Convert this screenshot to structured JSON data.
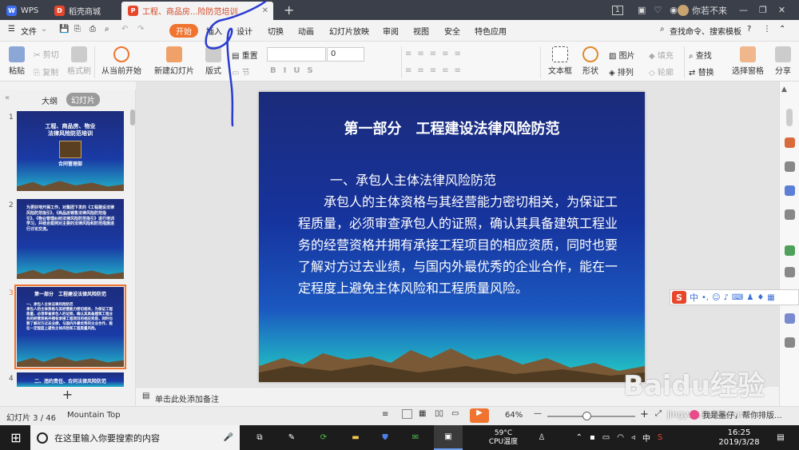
{
  "titlebar": {
    "tabs": [
      {
        "label": "WPS",
        "icon": "wps-logo-icon",
        "color": "#3c6df0"
      },
      {
        "label": "稻壳商城",
        "icon": "docer-icon",
        "color": "#e8462b"
      },
      {
        "label": "工程、商品房...险防范培训",
        "icon": "presentation-icon",
        "color": "#e8462b",
        "active": true
      }
    ],
    "page_badge": "1",
    "username": "你若不来"
  },
  "menubar": {
    "file": "文件",
    "tabs": [
      "开始",
      "插入",
      "设计",
      "切换",
      "动画",
      "幻灯片放映",
      "审阅",
      "视图",
      "安全",
      "特色应用"
    ],
    "search": "查找命令、搜索模板"
  },
  "ribbon": {
    "paste": "粘贴",
    "cut": "剪切",
    "copy": "复制",
    "format_painter": "格式刷",
    "from_current": "从当前开始",
    "new_slide": "新建幻灯片",
    "layout": "版式",
    "reset": "重置",
    "section": "节",
    "font_size": "0",
    "textbox": "文本框",
    "shape": "形状",
    "picture": "图片",
    "arrange": "排列",
    "fill": "填充",
    "outline": "轮廓",
    "find": "查找",
    "replace": "替换",
    "selection_pane": "选择窗格",
    "share": "分享"
  },
  "leftpanel": {
    "tabs": [
      "大纲",
      "幻灯片"
    ],
    "thumbs": [
      {
        "num": "1",
        "title": "工程、商品房、物业\n法律风险防范培训",
        "sub": "合同管理部"
      },
      {
        "num": "2",
        "text": "为更好地开展工作，对集团下发的《工程建设法律风险防范指引》、《商品房销售法律风险防范指引》、《物业管理纠纷法律风险防范指引》进行培训学习，并结合案例对主要的法律风险和防范措施进行讨论交流。"
      },
      {
        "num": "3",
        "title": "第一部分　工程建设法律风险防范",
        "text": "一、承包人主体法律风险防范\n承包人的主体资格与其经营能力密切相关，为保证工程质量，必须审查承包人的证照，确认其具备建筑工程业务的经营资格并拥有承接工程项目的相应资质，同时也要了解对方过去业绩，与国内外最优秀的企业合作，能在一定程度上避免主体风险和工程质量风险。"
      },
      {
        "num": "4",
        "text": "二、违约责任、合同法律风险防范"
      }
    ],
    "add": "+"
  },
  "slide": {
    "title": "第一部分　工程建设法律风险防范",
    "heading": "一、承包人主体法律风险防范",
    "body": "承包人的主体资格与其经营能力密切相关，为保证工程质量，必须审查承包人的证照，确认其具备建筑工程业务的经营资格并拥有承接工程项目的相应资质，同时也要了解对方过去业绩，与国内外最优秀的企业合作，能在一定程度上避免主体风险和工程质量风险。"
  },
  "notes": "单击此处添加备注",
  "statusbar": {
    "slide_index": "幻灯片 3 / 46",
    "theme": "Mountain Top",
    "zoom": "64%",
    "zoom_fraction": 0.45
  },
  "ime": {
    "mode": "中"
  },
  "taskbar": {
    "search_placeholder": "在这里输入你要搜索的内容",
    "temp": "59°C",
    "temp_label": "CPU温度",
    "time": "16:25",
    "date": "2019/3/28",
    "ime_lang": "中"
  },
  "overlay": {
    "watermark": "Baidu经验",
    "watermark_sub": "jingyan.baidu.com",
    "hint": "我是墨仔，帮你排版..."
  },
  "colors": {
    "accent": "#f0732f",
    "titlebar": "#3b3f4a",
    "slide_top": "#1b2b7a",
    "pen": "#2b3bd0"
  }
}
